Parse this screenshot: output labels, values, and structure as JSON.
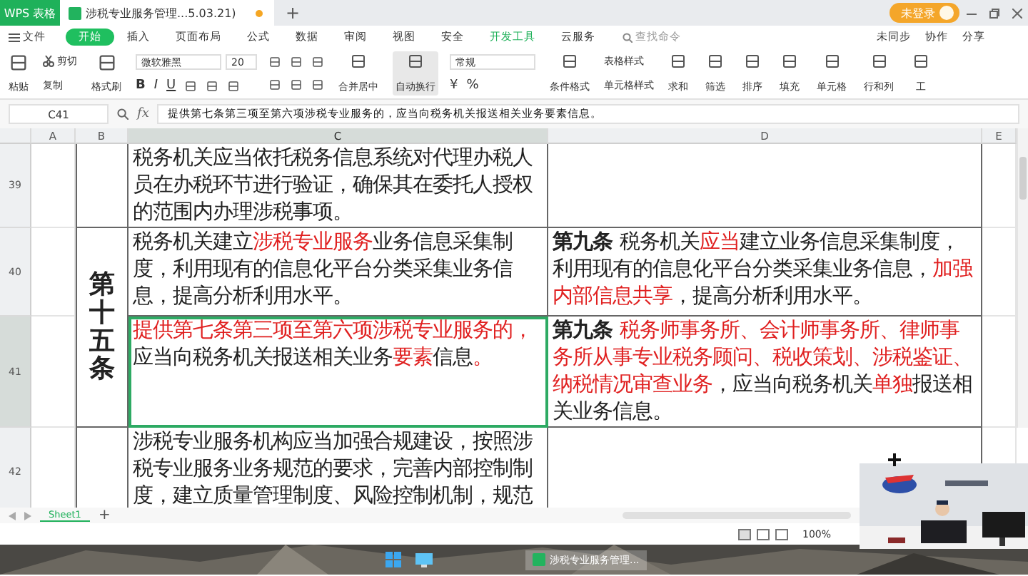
{
  "title_bar": {
    "app": "WPS 表格",
    "doc_tab": "涉税专业服务管理...5.03.21)",
    "new_tab": "+",
    "login": "未登录"
  },
  "menu": {
    "file": "文件",
    "tabs": [
      {
        "label": "开始",
        "selected": true
      },
      {
        "label": "插入",
        "selected": false
      },
      {
        "label": "页面布局",
        "selected": false
      },
      {
        "label": "公式",
        "selected": false
      },
      {
        "label": "数据",
        "selected": false
      },
      {
        "label": "审阅",
        "selected": false
      },
      {
        "label": "视图",
        "selected": false
      },
      {
        "label": "安全",
        "selected": false
      },
      {
        "label": "开发工具",
        "selected": false
      },
      {
        "label": "云服务",
        "selected": false
      }
    ],
    "search_placeholder": "查找命令",
    "right": [
      "未同步",
      "协作",
      "分享"
    ]
  },
  "ribbon": {
    "paste": "粘贴",
    "cut": "剪切",
    "copy": "复制",
    "format_painter": "格式刷",
    "font": "微软雅黑",
    "font_size": "20",
    "bold": "B",
    "italic": "I",
    "underline": "U",
    "merge": "合并居中",
    "wrap": "自动换行",
    "number_format": "常规",
    "number_symbols": [
      "¥",
      "%"
    ],
    "conditional": "条件格式",
    "table_style": "表格样式",
    "cell_style": "单元格样式",
    "tools": [
      "求和",
      "筛选",
      "排序",
      "填充",
      "单元格",
      "行和列",
      "工"
    ]
  },
  "formula_bar": {
    "cell_ref": "C41",
    "fx": "fx",
    "content": "提供第七条第三项至第六项涉税专业服务的，应当向税务机关报送相关业务要素信息。"
  },
  "columns": [
    "A",
    "B",
    "C",
    "D",
    "E"
  ],
  "merged_b": {
    "text": "第十五条"
  },
  "rows": [
    {
      "number": "39",
      "c": [
        {
          "kind": "plain",
          "text": "税务机关应当依托税务信息系统对代理办税人员在办税环节进行验证，确保其在委托人授权的范围内办理涉税事项。"
        }
      ],
      "d": []
    },
    {
      "number": "40",
      "c": [
        {
          "kind": "plain",
          "text": "税务机关建立"
        },
        {
          "kind": "emphasis",
          "text": "涉税专业服务"
        },
        {
          "kind": "plain",
          "text": "业务信息采集制度，利用现有的信息化平台分类采集业务信息，提高分析利用水平。"
        }
      ],
      "d": [
        {
          "kind": "heading",
          "text": "第九条 "
        },
        {
          "kind": "plain",
          "text": "税务机关"
        },
        {
          "kind": "emphasis",
          "text": "应当"
        },
        {
          "kind": "plain",
          "text": "建立业务信息采集制度，利用现有的信息化平台分类采集业务信息，"
        },
        {
          "kind": "emphasis",
          "text": "加强内部信息共享"
        },
        {
          "kind": "plain",
          "text": "，提高分析利用水平。"
        }
      ]
    },
    {
      "number": "41",
      "selected": true,
      "c": [
        {
          "kind": "emphasis",
          "text": "提供第七条第三项至第六项涉税专业服务的，"
        },
        {
          "kind": "plain",
          "text": "应当向税务机关报送相关业务"
        },
        {
          "kind": "emphasis",
          "text": "要素"
        },
        {
          "kind": "plain",
          "text": "信息"
        },
        {
          "kind": "emphasis",
          "text": "。"
        }
      ],
      "d": [
        {
          "kind": "heading",
          "text": "第九条 "
        },
        {
          "kind": "emphasis",
          "text": "税务师事务所、会计师事务所、律师事务所从事专业税务顾问、税收策划、涉税鉴证、纳税情况审查业务"
        },
        {
          "kind": "plain",
          "text": "，应当向税务机关"
        },
        {
          "kind": "emphasis",
          "text": "单独"
        },
        {
          "kind": "plain",
          "text": "报送相关业务信息。"
        }
      ]
    },
    {
      "number": "42",
      "c": [
        {
          "kind": "plain",
          "text": "涉税专业服务机构应当加强合规建设，按照涉税专业服务业务规范的要求，完善内部控制制度，建立质量管理制度、风险控制机制，规范"
        }
      ],
      "d": []
    }
  ],
  "sheet_tabs": [
    {
      "label": "Sheet1",
      "selected": true
    }
  ],
  "add_sheet": "+",
  "status_bar": {
    "zoom": "100%"
  },
  "video_overlay": {
    "kind": "picture"
  },
  "taskbar": {
    "app": "涉税专业服务管理..."
  }
}
